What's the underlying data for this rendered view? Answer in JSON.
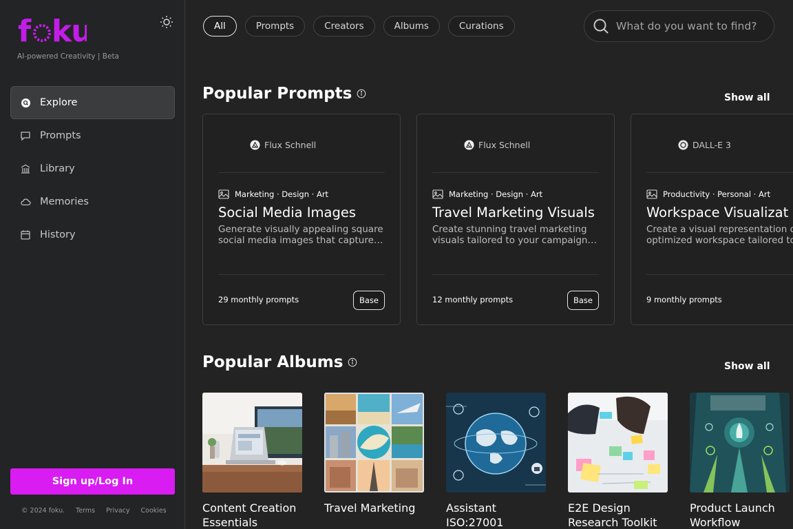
{
  "app": {
    "logo_text": "foku",
    "tagline": "AI-powered Creativity | Beta",
    "theme_icon": "sun-icon"
  },
  "nav": [
    {
      "label": "Explore",
      "icon": "explore-icon",
      "active": true
    },
    {
      "label": "Prompts",
      "icon": "chat-bubble-icon",
      "active": false
    },
    {
      "label": "Library",
      "icon": "library-icon",
      "active": false
    },
    {
      "label": "Memories",
      "icon": "cloud-icon",
      "active": false
    },
    {
      "label": "History",
      "icon": "calendar-icon",
      "active": false
    }
  ],
  "signup_label": "Sign up/Log In",
  "footer": {
    "copyright": "© 2024 foku.",
    "terms": "Terms",
    "privacy": "Privacy",
    "cookies": "Cookies"
  },
  "filters": [
    "All",
    "Prompts",
    "Creators",
    "Albums",
    "Curations"
  ],
  "active_filter": "All",
  "search": {
    "placeholder": "What do you want to find?"
  },
  "popular_prompts": {
    "title": "Popular Prompts",
    "show_all": "Show all",
    "cards": [
      {
        "model": "Flux Schnell",
        "model_icon": "flux-icon",
        "categories": "Marketing · Design · Art",
        "title": "Social Media Images",
        "desc_line1": "Generate visually appealing square",
        "desc_line2": "social media images that capture…",
        "monthly": "29 monthly prompts",
        "badge": "Base"
      },
      {
        "model": "Flux Schnell",
        "model_icon": "flux-icon",
        "categories": "Marketing · Design · Art",
        "title": "Travel Marketing Visuals",
        "desc_line1": "Create stunning travel marketing",
        "desc_line2": "visuals tailored to your campaigns…",
        "monthly": "12 monthly prompts",
        "badge": "Base"
      },
      {
        "model": "DALL-E 3",
        "model_icon": "openai-icon",
        "categories": "Productivity · Personal · Art",
        "title": "Workspace Visualizat",
        "desc_line1": "Create a visual representation o",
        "desc_line2": "optimized workspace tailored to",
        "monthly": "9 monthly prompts",
        "badge": ""
      }
    ]
  },
  "popular_albums": {
    "title": "Popular Albums",
    "show_all": "Show all",
    "items": [
      {
        "title_line1": "Content Creation",
        "title_line2": "Essentials"
      },
      {
        "title_line1": "Travel Marketing",
        "title_line2": ""
      },
      {
        "title_line1": "Assistant",
        "title_line2": "ISO:27001"
      },
      {
        "title_line1": "E2E Design",
        "title_line2": "Research Toolkit"
      },
      {
        "title_line1": "Product Launch",
        "title_line2": "Workflow"
      }
    ]
  },
  "colors": {
    "accent": "#d81cf2",
    "logo": "#c21de8",
    "background": "#232323"
  }
}
